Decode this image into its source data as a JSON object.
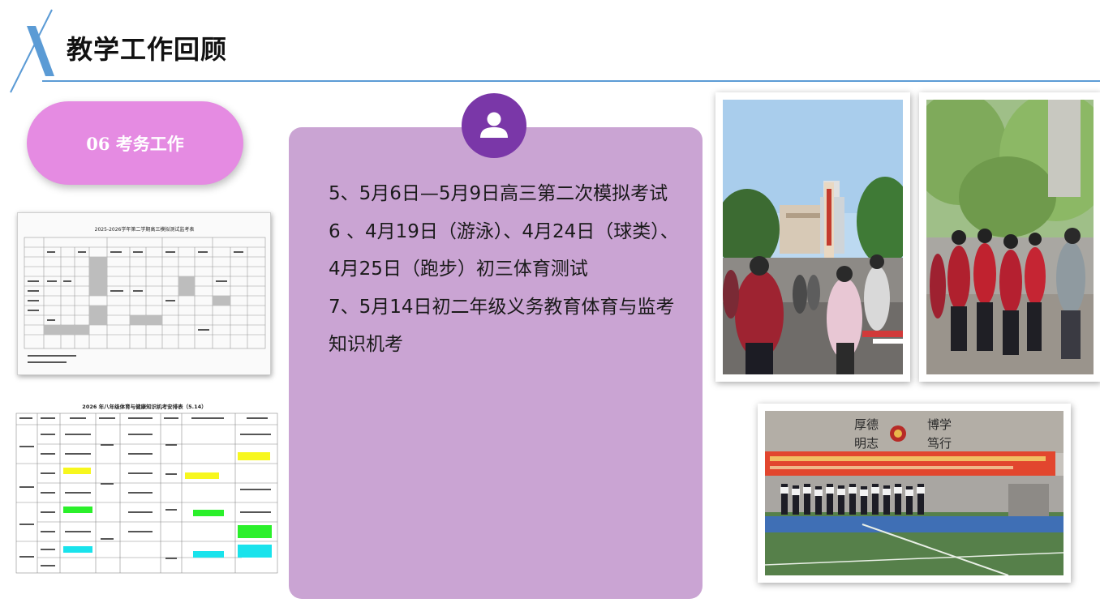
{
  "header": {
    "title": "教学工作回顾"
  },
  "section_pill": {
    "label": "06 考务工作"
  },
  "card": {
    "items": [
      "5、5月6日—5月9日高三第二次模拟考试",
      "6 、4月19日（游泳）、4月24日（球类）、4月25日（跑步）初三体育测试",
      "7、5月14日初二年级义务教育体育与监考知识机考"
    ]
  },
  "doc1": {
    "title": "2025-2026学年第二学期高三模拟测试监考表"
  },
  "doc2": {
    "title": "2026 年八年级体育与健康知识机考安排表（5.14）"
  },
  "photo3": {
    "motto_1": "厚德",
    "motto_2": "博学",
    "motto_3": "明志",
    "motto_4": "笃行"
  },
  "colors": {
    "accent_blue": "#5b9bd5",
    "pill": "#e58be2",
    "card": "#caa4d3",
    "avatar": "#7a37a8"
  },
  "icons": {
    "avatar": "user-icon"
  }
}
